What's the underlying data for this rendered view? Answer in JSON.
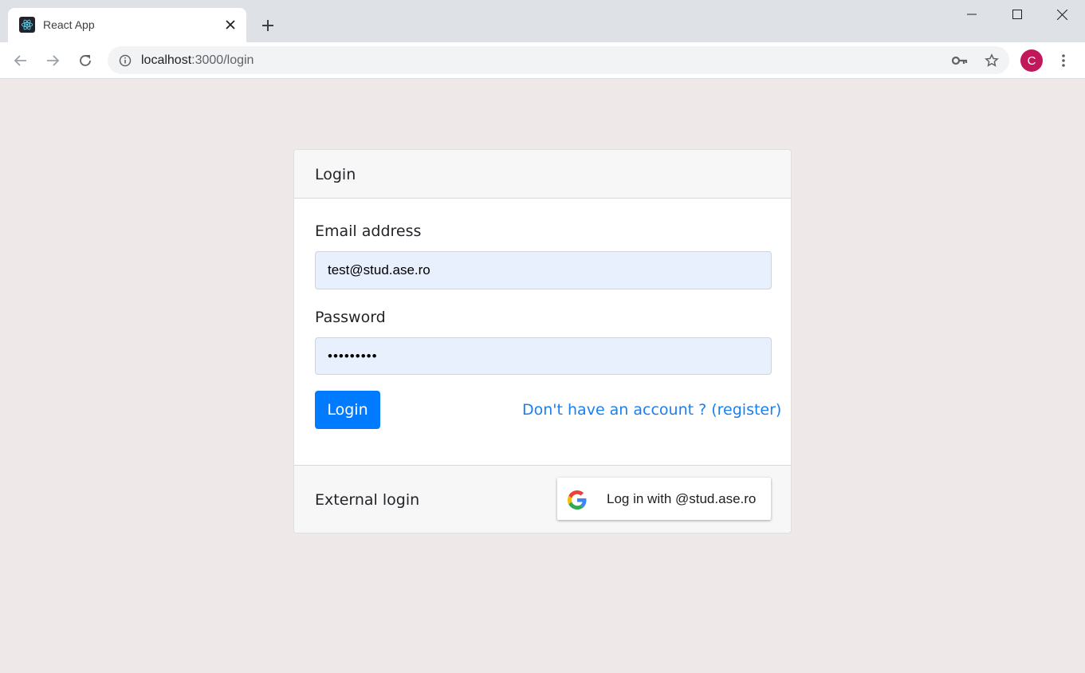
{
  "browser": {
    "tab_title": "React App",
    "url_host": "localhost",
    "url_path": ":3000/login",
    "profile_initial": "C",
    "profile_color": "#c2185b"
  },
  "card": {
    "header": "Login",
    "email_label": "Email address",
    "email_value": "test@stud.ase.ro",
    "password_label": "Password",
    "password_value": "123456789",
    "login_button": "Login",
    "register_link": "Don't have an account ? (register)",
    "external_label": "External login",
    "google_button": "Log in with @stud.ase.ro"
  },
  "colors": {
    "primary": "#007bff",
    "link": "#1a7ff0",
    "autofill_bg": "#e8f0fe",
    "page_bg": "#efe8e8"
  }
}
